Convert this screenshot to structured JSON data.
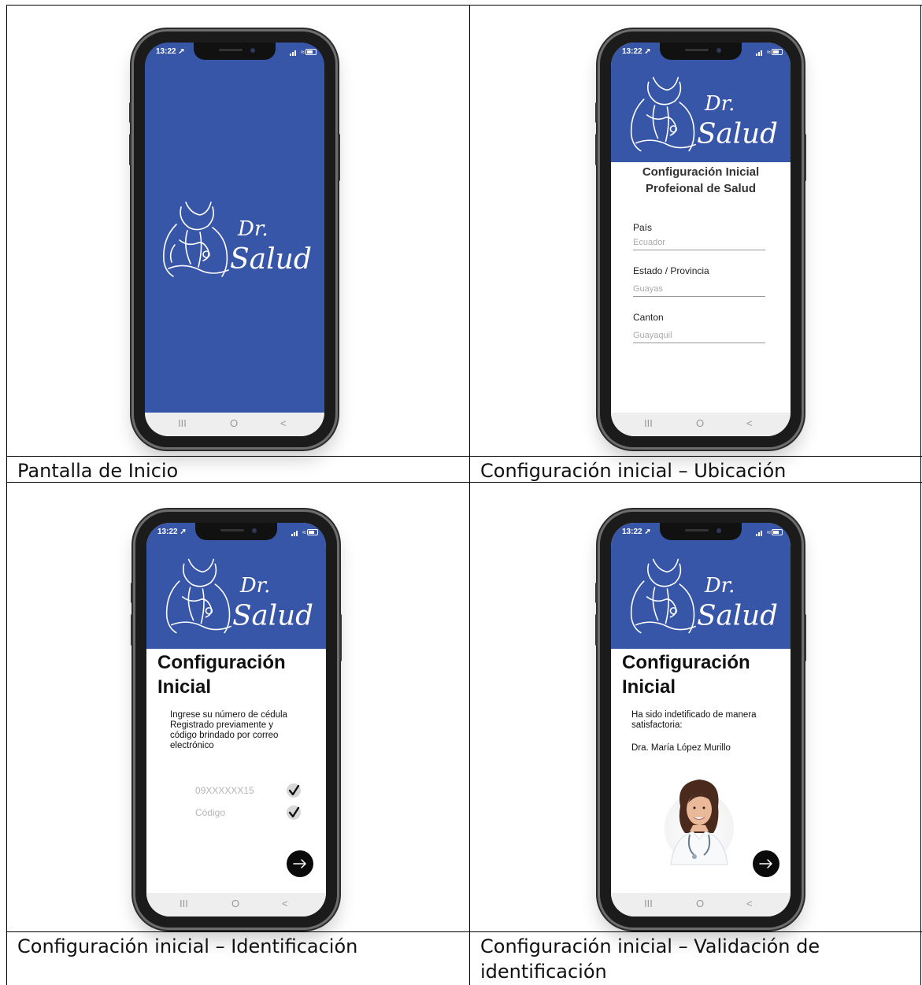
{
  "captions": {
    "c1": "Pantalla de Inicio",
    "c2": "Configuración inicial – Ubicación",
    "c3": "Configuración inicial – Identificación",
    "c4_line1": "Configuración inicial – Validación de",
    "c4_line2": "identificación"
  },
  "status": {
    "time": "13:22 ➚"
  },
  "nav": {
    "recent": "III",
    "home": "O",
    "back": "<"
  },
  "brand": {
    "line1": "Dr.",
    "line2": "Salud"
  },
  "screen2": {
    "title_line1": "Configuración Inicial",
    "title_line2": "Profeional de Salud",
    "fields": [
      {
        "label": "País",
        "value": "Ecuador"
      },
      {
        "label": "Estado / Provincia",
        "value": "Guayas"
      },
      {
        "label": "Canton",
        "value": "Guayaquil"
      }
    ]
  },
  "screen3": {
    "title_line1": "Configuración",
    "title_line2": "Inicial",
    "p1": "Ingrese su número de cédula",
    "p2": "Registrado previamente y",
    "p3": "código brindado por correo",
    "p4": "electrónico",
    "id_value": "09XXXXXX15",
    "code_placeholder": "Código"
  },
  "screen4": {
    "title_line1": "Configuración",
    "title_line2": "Inicial",
    "p1": "Ha sido indetificado de manera",
    "p2": "satisfactoria:",
    "name": "Dra. María López Murillo"
  },
  "colors": {
    "brand_blue": "#3856a8",
    "nav_gray": "#eeeeee"
  }
}
